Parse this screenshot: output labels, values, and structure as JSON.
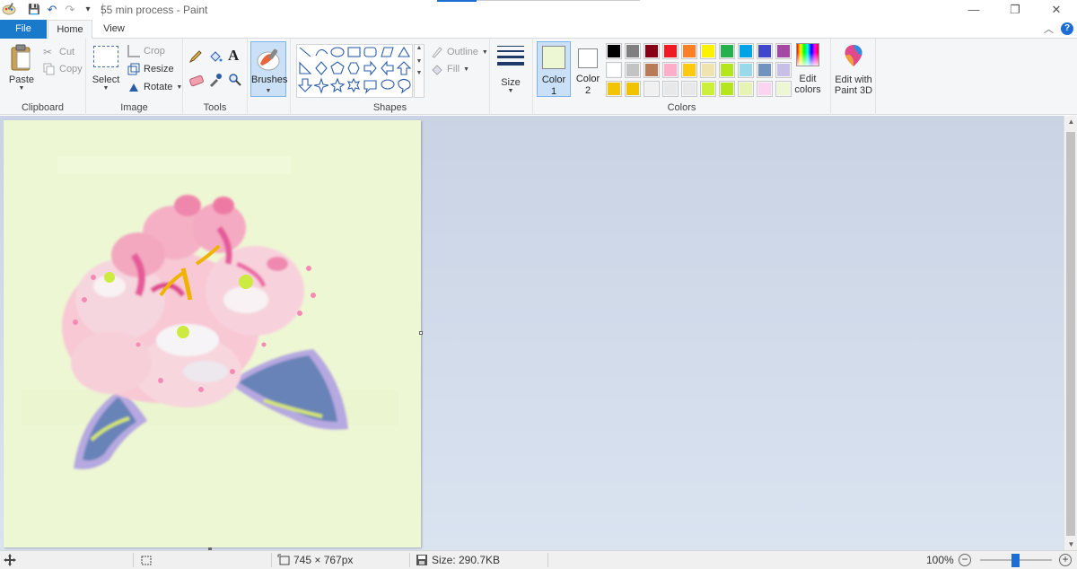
{
  "window": {
    "title": "55 min process - Paint",
    "minimize": "—",
    "restore": "❐",
    "close": "✕"
  },
  "qat": {
    "save": "💾",
    "undo": "↶",
    "redo": "↷",
    "customize": "▾"
  },
  "tabs": {
    "file": "File",
    "home": "Home",
    "view": "View"
  },
  "ribbon": {
    "clipboard": {
      "label": "Clipboard",
      "paste": "Paste",
      "cut": "Cut",
      "copy": "Copy"
    },
    "image": {
      "label": "Image",
      "select": "Select",
      "crop": "Crop",
      "resize": "Resize",
      "rotate": "Rotate"
    },
    "tools": {
      "label": "Tools"
    },
    "brushes": {
      "label": "Brushes"
    },
    "shapes": {
      "label": "Shapes",
      "outline": "Outline",
      "fill": "Fill"
    },
    "size": {
      "label": "Size"
    },
    "colors": {
      "label": "Colors",
      "color1": "Color",
      "color1_num": "1",
      "color2": "Color",
      "color2_num": "2",
      "color1_value": "#eef7d4",
      "color2_value": "#ffffff",
      "edit_colors_1": "Edit",
      "edit_colors_2": "colors",
      "palette": [
        [
          "#000000",
          "#7f7f7f",
          "#880015",
          "#ed1c24",
          "#ff7f27",
          "#fff200",
          "#22b14c",
          "#00a2e8",
          "#3f48cc",
          "#a349a4"
        ],
        [
          "#ffffff",
          "#c3c3c3",
          "#b97a57",
          "#ffaec9",
          "#ffc90e",
          "#efe4b0",
          "#b5e61d",
          "#99d9ea",
          "#7092be",
          "#c8bfe7"
        ],
        [
          "#f5c400",
          "#efc300",
          "#f0f0f0",
          "#e8e8e8",
          "#e8e8e8",
          "#ccf03a",
          "#b5e61d",
          "#e5f3b5",
          "#fad4f0",
          "#eef7d4"
        ]
      ]
    },
    "paint3d": {
      "line1": "Edit with",
      "line2": "Paint 3D"
    }
  },
  "status": {
    "dimensions": "745 × 767px",
    "size": "Size: 290.7KB",
    "zoom": "100%"
  }
}
